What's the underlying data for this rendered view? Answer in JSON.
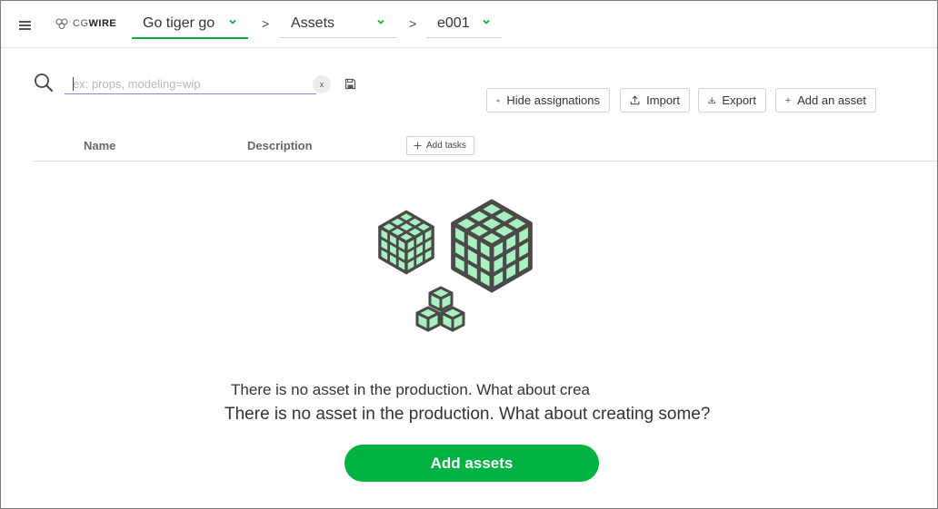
{
  "app": {
    "logo_text_light": "CG",
    "logo_text_bold": "WIRE"
  },
  "breadcrumb": {
    "production": "Go tiger go",
    "section": "Assets",
    "episode": "e001",
    "separator": ">"
  },
  "search": {
    "placeholder": "ex: props, modeling=wip",
    "value": "",
    "clear_label": "x"
  },
  "toolbar": {
    "hide_assignations_label": "Hide assignations",
    "import_label": "Import",
    "export_label": "Export",
    "add_asset_label": "Add an asset"
  },
  "table": {
    "columns": [
      "Name",
      "Description"
    ],
    "add_tasks_label": "Add tasks"
  },
  "empty_state": {
    "message_partial": "There is no asset in the production. What about crea",
    "message_full": "There is no asset in the production. What about creating some?",
    "cta_label": "Add assets"
  },
  "colors": {
    "accent": "#00b242",
    "input_underline": "#8b82d6",
    "cube_fill": "#a8f0c0",
    "cube_stroke": "#4a4a4a"
  }
}
